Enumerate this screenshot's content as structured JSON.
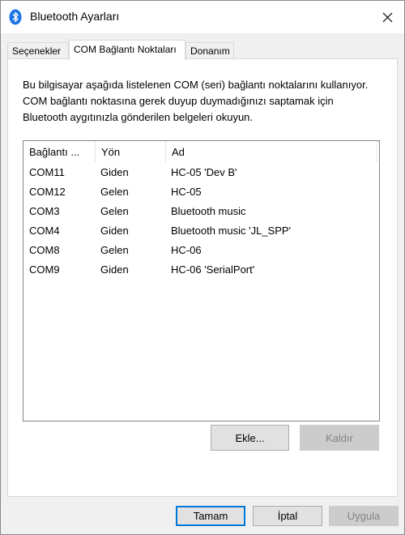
{
  "window": {
    "title": "Bluetooth Ayarları"
  },
  "tabs": [
    {
      "label": "Seçenekler",
      "active": false
    },
    {
      "label": "COM Bağlantı Noktaları",
      "active": true
    },
    {
      "label": "Donanım",
      "active": false
    }
  ],
  "description": "Bu bilgisayar aşağıda listelenen COM (seri) bağlantı noktalarını kullanıyor. COM bağlantı noktasına gerek duyup duymadığınızı saptamak için Bluetooth aygıtınızla gönderilen belgeleri okuyun.",
  "list": {
    "columns": [
      "Bağlantı ...",
      "Yön",
      "Ad"
    ],
    "rows": [
      [
        "COM11",
        "Giden",
        "HC-05 'Dev B'"
      ],
      [
        "COM12",
        "Gelen",
        "HC-05"
      ],
      [
        "COM3",
        "Gelen",
        "Bluetooth music"
      ],
      [
        "COM4",
        "Giden",
        "Bluetooth music 'JL_SPP'"
      ],
      [
        "COM8",
        "Gelen",
        "HC-06"
      ],
      [
        "COM9",
        "Giden",
        "HC-06 'SerialPort'"
      ]
    ]
  },
  "buttons": {
    "add": "Ekle...",
    "remove": "Kaldır",
    "ok": "Tamam",
    "cancel": "İptal",
    "apply": "Uygula"
  },
  "colors": {
    "accent": "#0078d7",
    "bluetooth_icon": "#1b74e4"
  }
}
